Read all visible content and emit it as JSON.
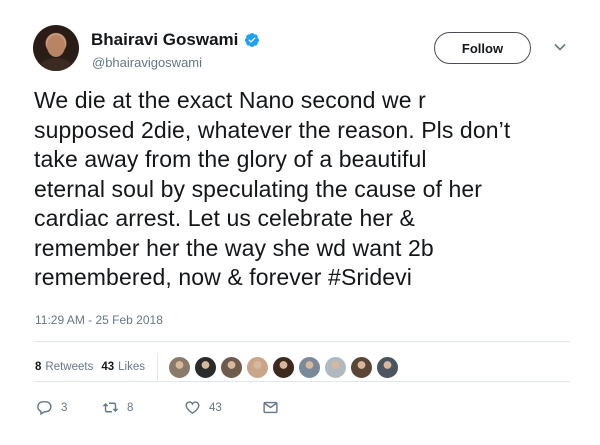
{
  "tweet": {
    "author_name": "Bhairavi Goswami",
    "author_handle": "@bhairavigoswami",
    "follow_label": "Follow",
    "text": "We die at the exact Nano second we r\nsupposed 2die, whatever the reason. Pls don’t\ntake away from the glory of a beautiful\neternal soul by speculating the cause of her\ncardiac arrest. Let us celebrate her &\nremember her the way she wd want 2b\nremembered, now & forever #Sridevi",
    "timestamp": "11:29 AM - 25 Feb 2018"
  },
  "stats": {
    "retweets_count": "8",
    "retweets_label": "Retweets",
    "likes_count": "43",
    "likes_label": "Likes",
    "liker_avatar_colors": [
      "#8a7a6a",
      "#2b2b2b",
      "#6f5a4e",
      "#c9a58a",
      "#3d2a1e",
      "#7a8a9a",
      "#b0b8c0",
      "#5a4636",
      "#4a5560"
    ]
  },
  "actions": {
    "reply_count": "3",
    "retweet_count": "8",
    "like_count": "43"
  },
  "colors": {
    "secondary_text": "#657786",
    "divider": "#e1e8ed",
    "verified": "#1da1f2"
  }
}
